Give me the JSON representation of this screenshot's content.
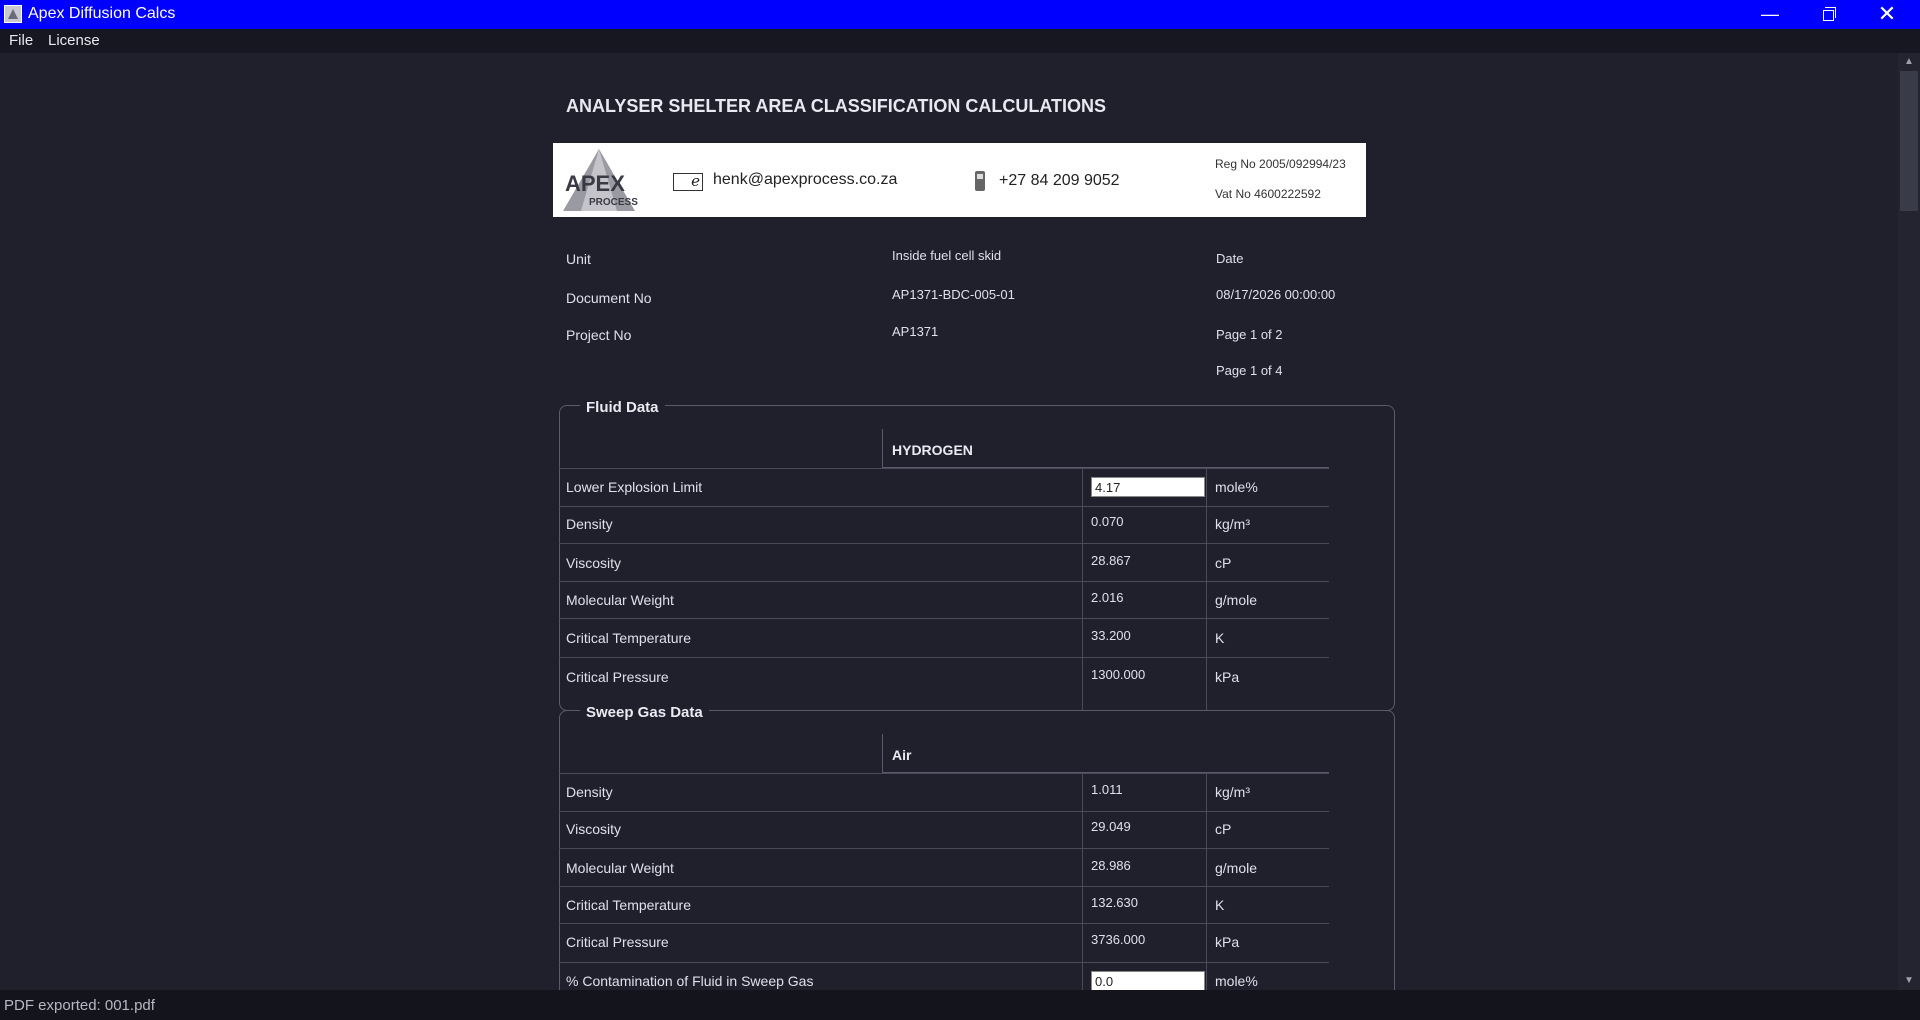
{
  "window": {
    "title": "Apex Diffusion Calcs",
    "minimize_glyph": "—",
    "close_glyph": "✕"
  },
  "menu": [
    "File",
    "License"
  ],
  "status": "PDF exported: 001.pdf",
  "scroll": {
    "up": "▲",
    "down": "▼"
  },
  "document": {
    "title": "ANALYSER SHELTER AREA CLASSIFICATION CALCULATIONS",
    "header": {
      "logo_text": "APEX",
      "logo_sub": "PROCESS",
      "email": "henk@apexprocess.co.za",
      "phone": "+27 84 209 9052",
      "reg_no": "Reg No 2005/092994/23",
      "vat_no": "Vat No  4600222592"
    },
    "meta": {
      "unit_label": "Unit",
      "unit_value": "Inside fuel cell skid",
      "date_label": "Date",
      "doc_label": "Document No",
      "doc_value": "AP1371-BDC-005-01",
      "date_value": "08/17/2026 00:00:00",
      "project_label": "Project No",
      "project_value": "AP1371",
      "page_a": "Page 1 of 2",
      "page_b": "Page 1 of 4"
    },
    "fluid": {
      "group_title": "Fluid Data",
      "column": "HYDROGEN",
      "rows": [
        {
          "label": "Lower Explosion Limit",
          "value": "4.17",
          "unit": "mole%"
        },
        {
          "label": "Density",
          "value": "0.070",
          "unit": "kg/m³"
        },
        {
          "label": "Viscosity",
          "value": "28.867",
          "unit": "cP"
        },
        {
          "label": "Molecular Weight",
          "value": "2.016",
          "unit": "g/mole"
        },
        {
          "label": "Critical Temperature",
          "value": "33.200",
          "unit": "K"
        },
        {
          "label": "Critical Pressure",
          "value": "1300.000",
          "unit": "kPa"
        }
      ]
    },
    "sweep": {
      "group_title": "Sweep Gas Data",
      "column": "Air",
      "rows": [
        {
          "label": "Density",
          "value": "1.011",
          "unit": "kg/m³"
        },
        {
          "label": "Viscosity",
          "value": "29.049",
          "unit": "cP"
        },
        {
          "label": "Molecular Weight",
          "value": "28.986",
          "unit": "g/mole"
        },
        {
          "label": "Critical Temperature",
          "value": "132.630",
          "unit": "K"
        },
        {
          "label": "Critical Pressure",
          "value": "3736.000",
          "unit": "kPa"
        },
        {
          "label": "% Contamination of Fluid in Sweep Gas",
          "value": "0.0",
          "unit": "mole%"
        }
      ]
    }
  }
}
